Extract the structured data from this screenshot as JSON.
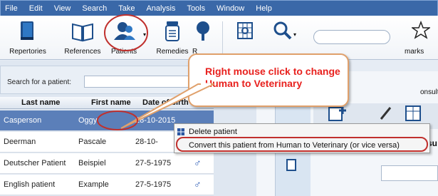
{
  "menu": [
    "File",
    "Edit",
    "View",
    "Search",
    "Take",
    "Analysis",
    "Tools",
    "Window",
    "Help"
  ],
  "toolbar": {
    "repertories": "Repertories",
    "references": "References",
    "patients": "Patients",
    "remedies": "Remedies",
    "remedies_cut": "R",
    "bookmarks_cut": "marks"
  },
  "search": {
    "label": "Search for a patient:",
    "value": ""
  },
  "grid": {
    "headers": [
      "Last name",
      "First name",
      "Date of birth"
    ],
    "rows": [
      {
        "last": "Casperson",
        "first": "Oggy",
        "dob": "28-10-2015"
      },
      {
        "last": "Deerman",
        "first": "Pascale",
        "dob": "28-10-"
      },
      {
        "last": "Deutscher Patient",
        "first": "Beispiel",
        "dob": "27-5-1975"
      },
      {
        "last": "English patient",
        "first": "Example",
        "dob": "27-5-1975"
      }
    ]
  },
  "right_fragments": {
    "consult": "onsult",
    "su": "su"
  },
  "callout": {
    "text": "Right mouse click to change Human to Veterinary"
  },
  "context_menu": {
    "delete": "Delete patient",
    "convert": "Convert this patient from Human to Veterinary (or vice versa)"
  },
  "colors": {
    "callout_text": "#e8211e",
    "highlight_oval": "#c0302d",
    "selection": "#5b7fb9",
    "menubar": "#3a68a8"
  }
}
